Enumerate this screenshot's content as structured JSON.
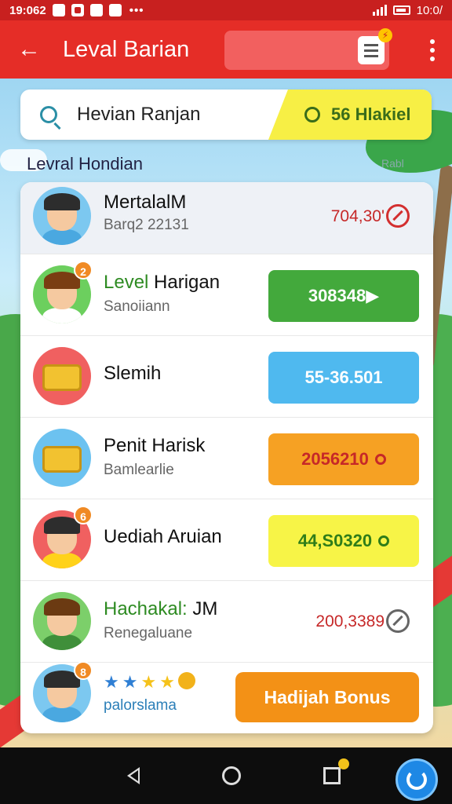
{
  "status": {
    "time": "19:062",
    "right_time": "10:0/",
    "dots": "•••"
  },
  "appbar": {
    "title": "Leval Barian"
  },
  "search": {
    "text": "Hevian Ranjan",
    "badge": "56 Hlakiel"
  },
  "section": {
    "title": "Levral Hondian",
    "link": "Rabl"
  },
  "rows": [
    {
      "name": "MertalalM",
      "sub": "Barq2 22131",
      "value": "704,30'"
    },
    {
      "name_hl": "Level",
      "name": " Harigan",
      "sub": "Sanoiiann",
      "value": "308348",
      "badge": "2"
    },
    {
      "name": "Slemih",
      "value": "55-36.501"
    },
    {
      "name": "Penit Harisk",
      "sub": "Bamlearlie",
      "value": "2056210"
    },
    {
      "name": "Uediah Aruian",
      "value": "44,S0320",
      "badge": "6"
    },
    {
      "name_hl": "Hachakal:",
      "name": " JM",
      "sub": "Renegaluane",
      "value": "200,3389"
    },
    {
      "sub": "palorslama",
      "button": "Hadijah Bonus",
      "badge": "8"
    }
  ]
}
